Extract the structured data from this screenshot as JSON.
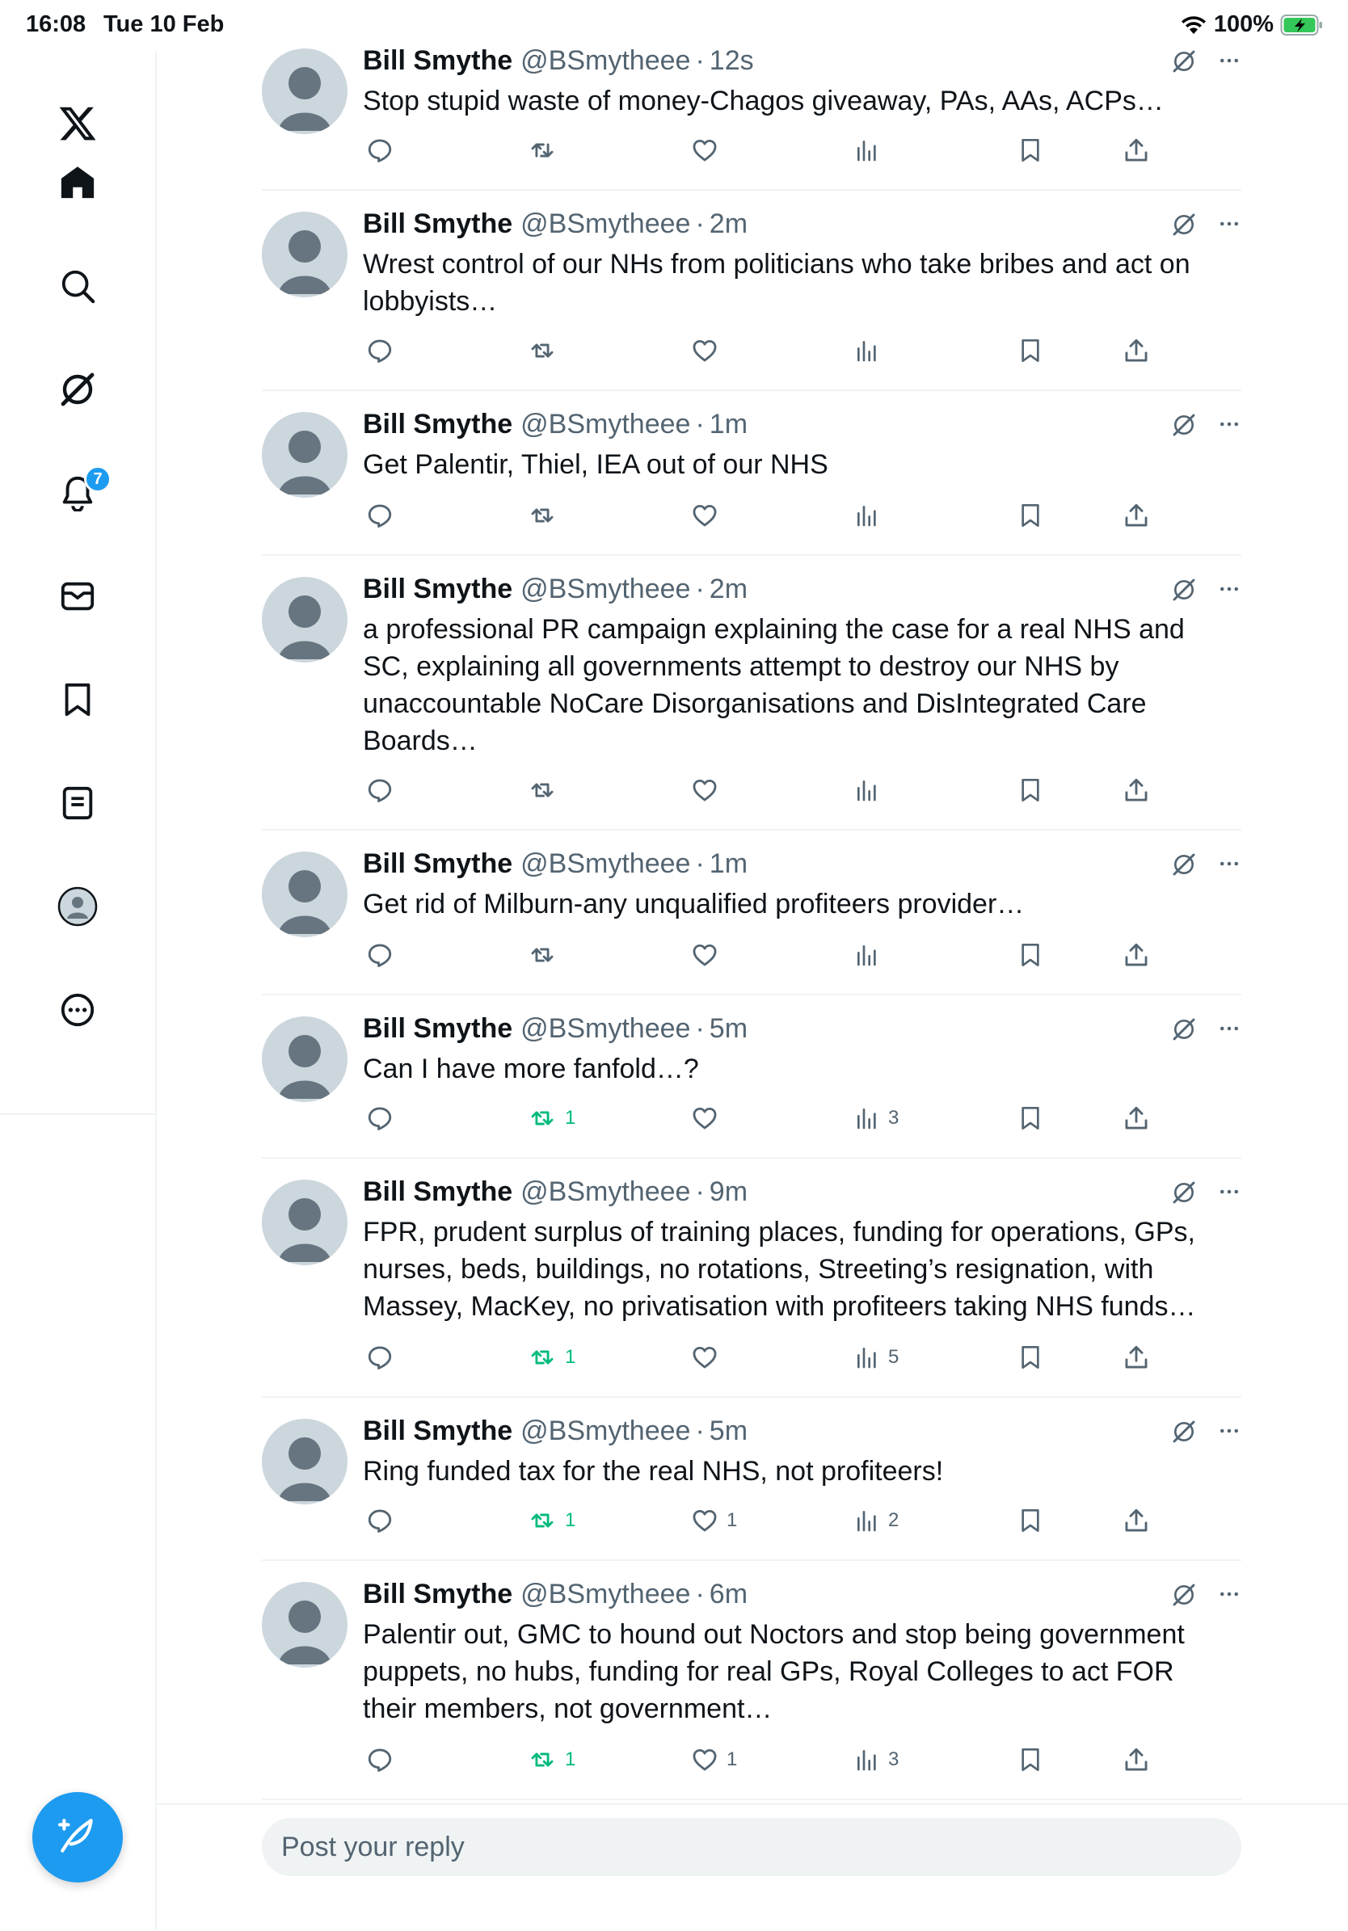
{
  "status_bar": {
    "time": "16:08",
    "date": "Tue 10 Feb",
    "battery": "100%"
  },
  "sidebar": {
    "items": [
      {
        "name": "x-logo",
        "icon": "x-logo-icon"
      },
      {
        "name": "home",
        "icon": "home-icon"
      },
      {
        "name": "explore",
        "icon": "search-icon"
      },
      {
        "name": "grok",
        "icon": "grok-icon"
      },
      {
        "name": "notifications",
        "icon": "bell-icon",
        "badge": "7"
      },
      {
        "name": "messages",
        "icon": "mail-icon"
      },
      {
        "name": "bookmarks",
        "icon": "bookmark-icon"
      },
      {
        "name": "lists",
        "icon": "list-icon"
      },
      {
        "name": "profile",
        "icon": "avatar-icon"
      },
      {
        "name": "more",
        "icon": "more-circle-icon"
      }
    ],
    "compose_icon": "compose-feather-icon"
  },
  "tweets": [
    {
      "author": "Bill Smythe",
      "handle": "@BSmytheee",
      "time": "12s",
      "text": "Stop stupid waste of money-Chagos giveaway, PAs, AAs, ACPs…",
      "retweets": "",
      "likes": "",
      "views": ""
    },
    {
      "author": "Bill Smythe",
      "handle": "@BSmytheee",
      "time": "2m",
      "text": "Wrest control of our NHs from politicians who take bribes and act on lobbyists…",
      "retweets": "",
      "likes": "",
      "views": ""
    },
    {
      "author": "Bill Smythe",
      "handle": "@BSmytheee",
      "time": "1m",
      "text": "Get Palentir, Thiel, IEA out of our NHS",
      "retweets": "",
      "likes": "",
      "views": ""
    },
    {
      "author": "Bill Smythe",
      "handle": "@BSmytheee",
      "time": "2m",
      "text": "a professional PR campaign explaining the case for a real NHS and SC, explaining all governments attempt to destroy our NHS by unaccountable NoCare Disorganisations and DisIntegrated Care Boards…",
      "retweets": "",
      "likes": "",
      "views": ""
    },
    {
      "author": "Bill Smythe",
      "handle": "@BSmytheee",
      "time": "1m",
      "text": "Get rid of Milburn-any unqualified profiteers provider…",
      "retweets": "",
      "likes": "",
      "views": ""
    },
    {
      "author": "Bill Smythe",
      "handle": "@BSmytheee",
      "time": "5m",
      "text": "Can I have more fanfold…?",
      "retweets": "1",
      "likes": "",
      "views": "3"
    },
    {
      "author": "Bill Smythe",
      "handle": "@BSmytheee",
      "time": "9m",
      "text": "FPR, prudent surplus of training places, funding for operations, GPs, nurses, beds, buildings, no rotations, Streeting’s resignation, with Massey, MacKey, no privatisation with profiteers taking NHS funds…",
      "retweets": "1",
      "likes": "",
      "views": "5"
    },
    {
      "author": "Bill Smythe",
      "handle": "@BSmytheee",
      "time": "5m",
      "text": "Ring funded tax for the real NHS, not profiteers!",
      "retweets": "1",
      "likes": "1",
      "views": "2"
    },
    {
      "author": "Bill Smythe",
      "handle": "@BSmytheee",
      "time": "6m",
      "text": "Palentir out, GMC to hound out Noctors and stop being government puppets, no hubs, funding for real GPs, Royal Colleges to act FOR their members, not government…",
      "retweets": "1",
      "likes": "1",
      "views": "3"
    }
  ],
  "reply": {
    "placeholder": "Post your reply"
  },
  "colors": {
    "accent": "#1d9bf0",
    "retweet_active": "#00ba7c",
    "secondary_text": "#536471",
    "divider": "#eff3f4",
    "avatar_bg": "#ccd6dd",
    "avatar_fg": "#66757f"
  }
}
